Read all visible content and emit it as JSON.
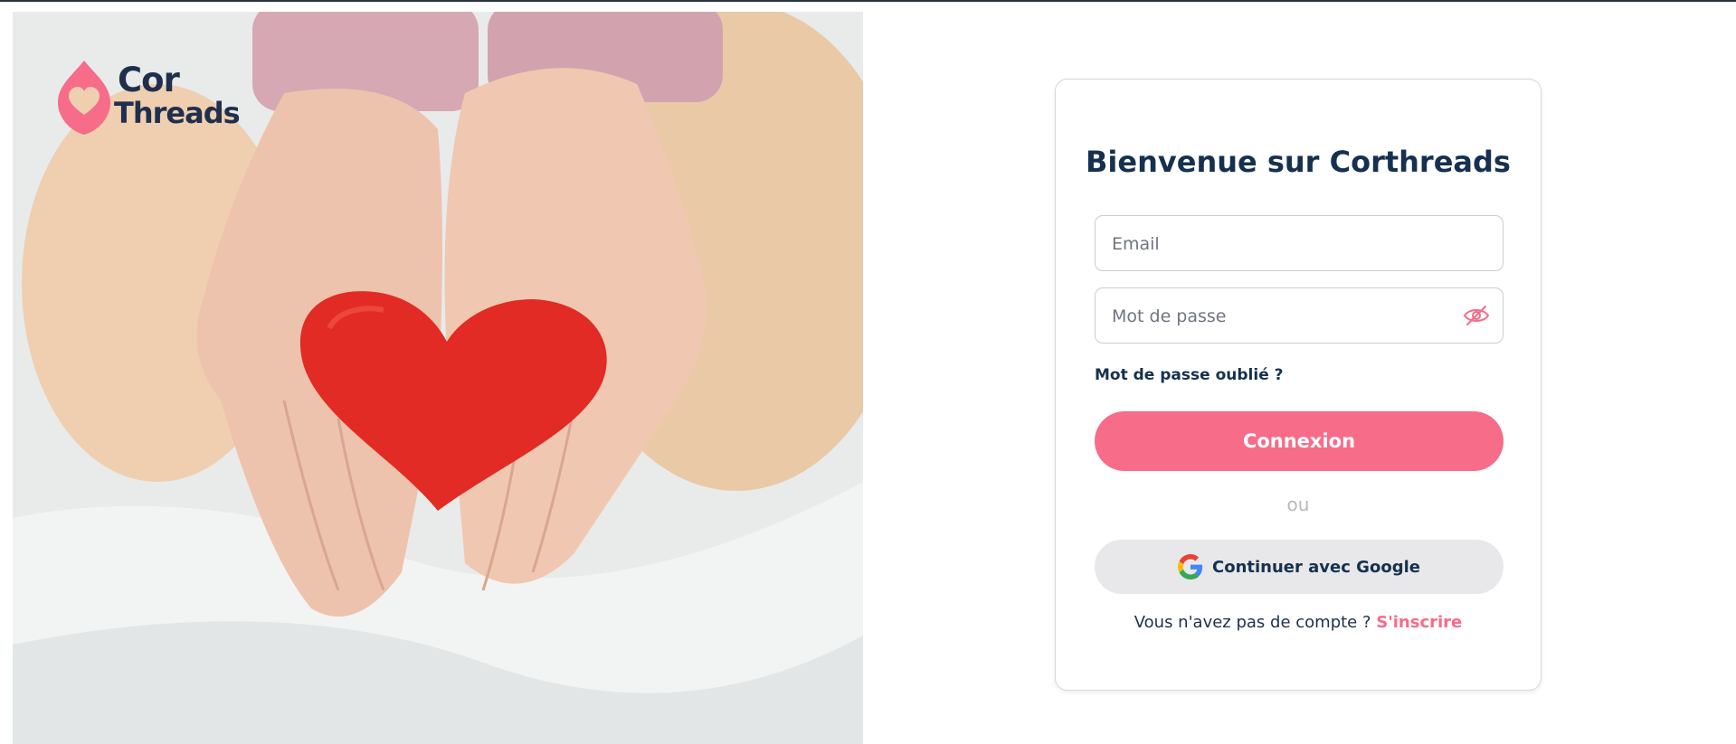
{
  "brand": {
    "logo_line1": "Cor",
    "logo_line2": "Threads",
    "logo_icon": "heart-drop-icon",
    "accent_color": "#f76c88",
    "navy_color": "#16304f"
  },
  "photo": {
    "subject": "hands-holding-red-heart",
    "heart_color": "#e12b24"
  },
  "login": {
    "title": "Bienvenue sur Corthreads",
    "email_placeholder": "Email",
    "password_placeholder": "Mot de passe",
    "password_toggle_icon": "eye-slash-icon",
    "forgot_label": "Mot de passe oublié ?",
    "submit_label": "Connexion",
    "separator": "ou",
    "google_label": "Continuer avec Google",
    "google_icon": "google-icon",
    "no_account_text": "Vous n'avez pas de compte ?",
    "signup_label": "S'inscrire"
  }
}
